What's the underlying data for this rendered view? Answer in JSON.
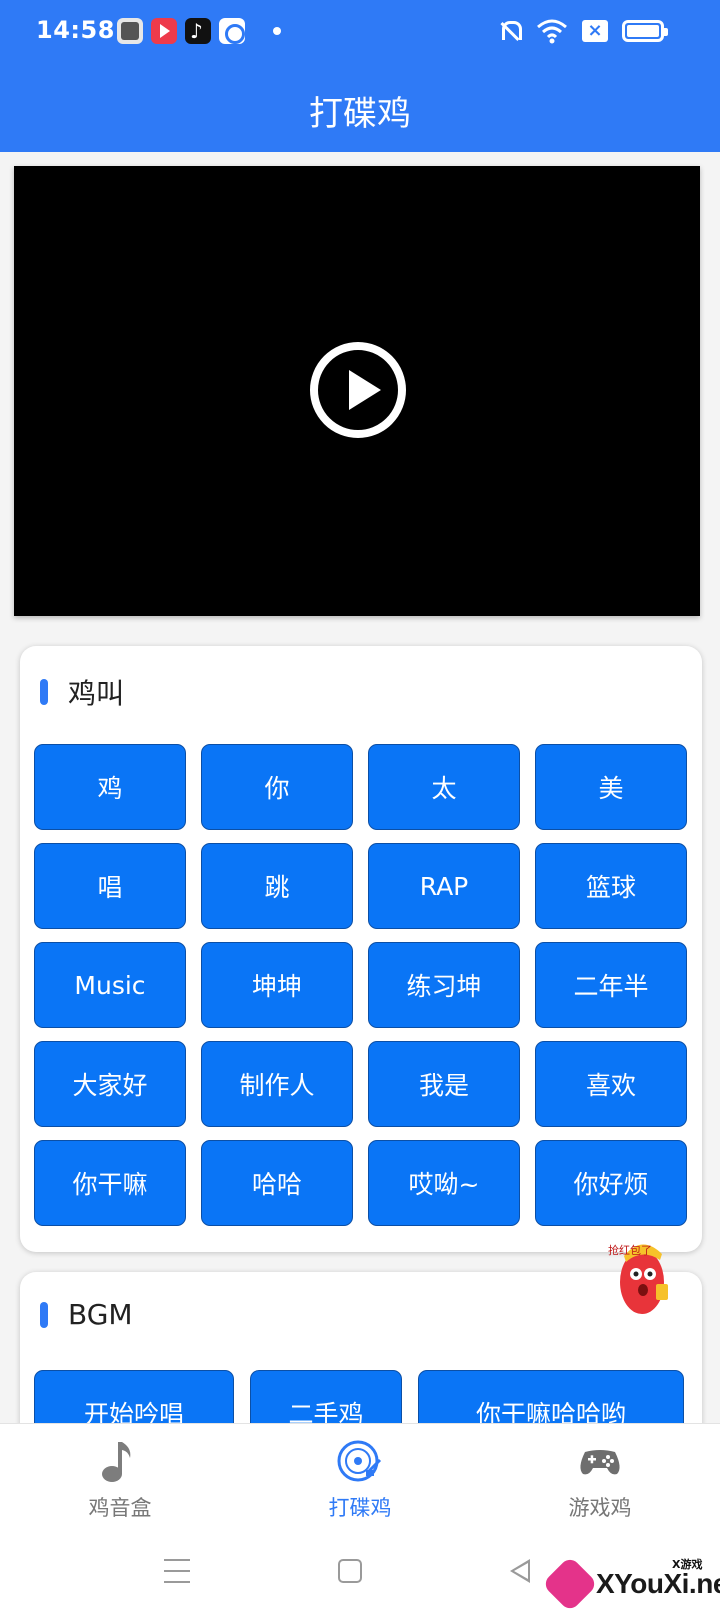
{
  "status_bar": {
    "time": "14:58"
  },
  "app_bar": {
    "title": "打碟鸡"
  },
  "video": {
    "state": "paused"
  },
  "sections": {
    "chicken_calls": {
      "title": "鸡叫",
      "buttons": [
        "鸡",
        "你",
        "太",
        "美",
        "唱",
        "跳",
        "RAP",
        "篮球",
        "Music",
        "坤坤",
        "练习坤",
        "二年半",
        "大家好",
        "制作人",
        "我是",
        "喜欢",
        "你干嘛",
        "哈哈",
        "哎呦~",
        "你好烦"
      ]
    },
    "bgm": {
      "title": "BGM",
      "buttons": [
        "开始吟唱",
        "二手鸡",
        "你干嘛哈哈哟"
      ]
    }
  },
  "bottom_nav": {
    "items": [
      {
        "label": "鸡音盒",
        "icon": "music-note-icon",
        "active": false
      },
      {
        "label": "打碟鸡",
        "icon": "disc-icon",
        "active": true
      },
      {
        "label": "游戏鸡",
        "icon": "gamepad-icon",
        "active": false
      }
    ]
  },
  "floating_badge": {
    "text": "抢红包了"
  },
  "watermark": {
    "text": "XYouXi.net",
    "small": "X游戏"
  },
  "colors": {
    "primary": "#2f7af6",
    "button": "#0a75f6"
  }
}
